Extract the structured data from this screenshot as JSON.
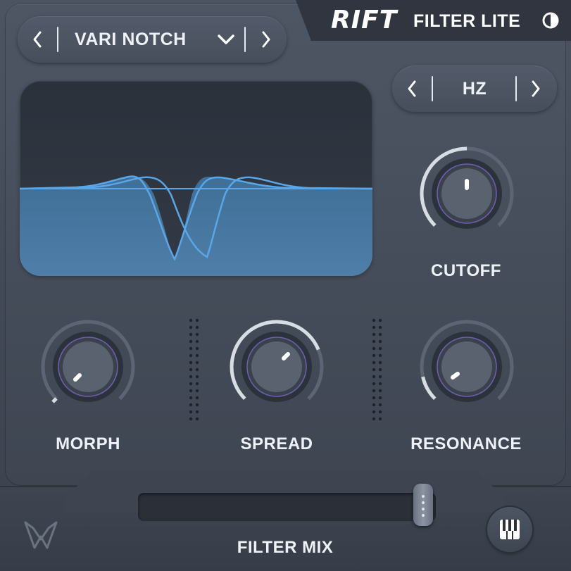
{
  "header": {
    "logo": "RIFT",
    "product": "FILTER LITE",
    "theme_icon": "half-circle-icon"
  },
  "filter_type": {
    "value": "VARI NOTCH",
    "prev_icon": "chevron-left-icon",
    "dropdown_icon": "chevron-down-icon",
    "next_icon": "chevron-right-icon"
  },
  "unit_selector": {
    "value": "HZ",
    "prev_icon": "chevron-left-icon",
    "next_icon": "chevron-right-icon"
  },
  "knobs": {
    "cutoff": {
      "label": "CUTOFF",
      "value": 0.5
    },
    "morph": {
      "label": "MORPH",
      "value": 0.0
    },
    "spread": {
      "label": "SPREAD",
      "value": 0.75
    },
    "resonance": {
      "label": "RESONANCE",
      "value": 0.12
    }
  },
  "filter_mix": {
    "label": "FILTER MIX",
    "value": 1.0
  },
  "footer": {
    "brand_icon": "brand-logo-icon",
    "piano_icon": "piano-keys-icon"
  },
  "colors": {
    "accent_blue": "#5aa6e6",
    "fill_blue": "#3f6e97",
    "arc_light": "#d8dce3",
    "arc_dark": "#5d6574"
  }
}
